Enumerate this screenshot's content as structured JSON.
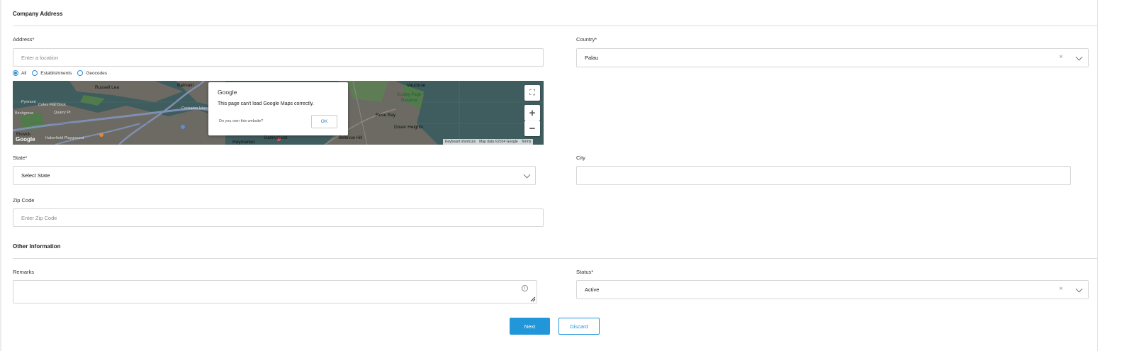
{
  "company_address": {
    "section_title": "Company Address",
    "address": {
      "label": "Address*",
      "placeholder": "Enter a location"
    },
    "country": {
      "label": "Country*",
      "value": "Palau"
    },
    "radio_options": [
      {
        "label": "All",
        "selected": true
      },
      {
        "label": "Establishments",
        "selected": false
      },
      {
        "label": "Geocodes",
        "selected": false
      }
    ],
    "map": {
      "place_labels": [
        "Russell Lea",
        "Balmain",
        "Vaucluse",
        "Dudley Page",
        "Reserve",
        "Cockatoo Island",
        "Coles Flat Dock",
        "Rose Bay",
        "Dover Heights",
        "Birchgrove",
        "Haymarket",
        "Darlinghurst",
        "Bellevue Hill",
        "Pyrmont",
        "Quarry Pt",
        "Haberfield Playground",
        "Elswick"
      ],
      "dialog": {
        "brand": "Google",
        "message": "This page can't load Google Maps correctly.",
        "own_site": "Do you own this website?",
        "ok_label": "OK"
      },
      "attribution": {
        "shortcuts": "Keyboard shortcuts",
        "map_data": "Map data ©2024 Google",
        "terms": "Terms"
      },
      "logo": "Google"
    },
    "state": {
      "label": "State*",
      "value": "Select State"
    },
    "city": {
      "label": "City",
      "value": ""
    },
    "zip": {
      "label": "Zip Code",
      "placeholder": "Enter Zip Code"
    }
  },
  "other_information": {
    "section_title": "Other Information",
    "remarks": {
      "label": "Remarks",
      "value": ""
    },
    "status": {
      "label": "Status*",
      "value": "Active"
    }
  },
  "actions": {
    "next_label": "Next",
    "discard_label": "Discard"
  },
  "colors": {
    "primary": "#2196d9",
    "border": "#d6d6d6",
    "map_water": "#3f5c5e"
  }
}
